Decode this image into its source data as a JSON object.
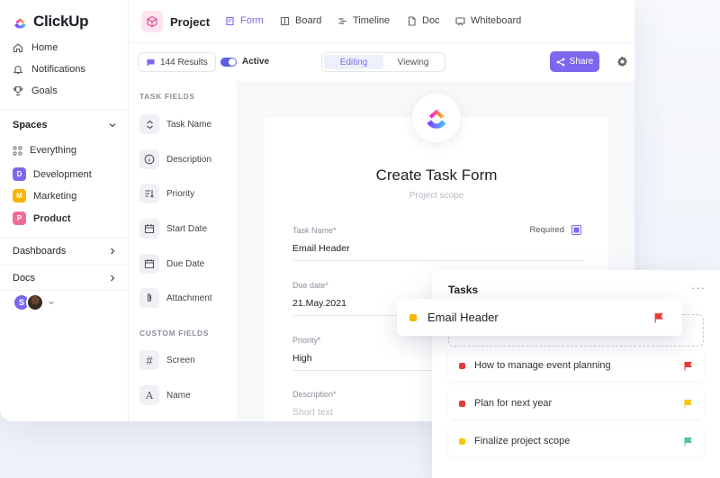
{
  "app": {
    "name": "ClickUp"
  },
  "sidebar": {
    "nav": [
      {
        "label": "Home",
        "icon": "home-icon"
      },
      {
        "label": "Notifications",
        "icon": "bell-icon"
      },
      {
        "label": "Goals",
        "icon": "trophy-icon"
      }
    ],
    "spaces_label": "Spaces",
    "everything_label": "Everything",
    "spaces": [
      {
        "letter": "D",
        "label": "Development",
        "color": "#7b68ee"
      },
      {
        "letter": "M",
        "label": "Marketing",
        "color": "#f7b500"
      },
      {
        "letter": "P",
        "label": "Product",
        "color": "#f06a9a"
      }
    ],
    "dashboards_label": "Dashboards",
    "docs_label": "Docs",
    "avatar_letter": "S"
  },
  "header": {
    "project_title": "Project",
    "tabs": [
      {
        "label": "Form",
        "icon": "form-icon"
      },
      {
        "label": "Board",
        "icon": "board-icon"
      },
      {
        "label": "Timeline",
        "icon": "timeline-icon"
      },
      {
        "label": "Doc",
        "icon": "doc-icon"
      },
      {
        "label": "Whiteboard",
        "icon": "whiteboard-icon"
      }
    ]
  },
  "toolbar": {
    "results": "144 Results",
    "active_label": "Active",
    "editing": "Editing",
    "viewing": "Viewing",
    "share": "Share"
  },
  "fields_panel": {
    "task_fields_head": "TASK FIELDS",
    "task_fields": [
      {
        "label": "Task Name",
        "icon": "task-name-icon"
      },
      {
        "label": "Description",
        "icon": "info-icon"
      },
      {
        "label": "Priority",
        "icon": "priority-icon"
      },
      {
        "label": "Start Date",
        "icon": "calendar-icon"
      },
      {
        "label": "Due Date",
        "icon": "calendar-icon"
      },
      {
        "label": "Attachment",
        "icon": "paperclip-icon"
      }
    ],
    "custom_fields_head": "CUSTOM FIELDS",
    "custom_fields": [
      {
        "label": "Screen",
        "glyph": "#"
      },
      {
        "label": "Name",
        "glyph": "A"
      }
    ]
  },
  "form": {
    "title": "Create Task Form",
    "subtitle": "Project scope",
    "required_label": "Required",
    "fields": [
      {
        "label": "Task Name*",
        "value": "Email Header"
      },
      {
        "label": "Due date*",
        "value": "21.May.2021"
      },
      {
        "label": "Priority*",
        "value": "High"
      },
      {
        "label": "Description*",
        "value": "Short text"
      }
    ]
  },
  "tasks_panel": {
    "title": "Tasks",
    "more": "···",
    "dragging": {
      "label": "Email Header",
      "dot_color": "#f7b500",
      "flag_color": "#e53935"
    },
    "items": [
      {
        "label": "How to manage event planning",
        "dot_color": "#e53935",
        "flag_color": "#e53935"
      },
      {
        "label": "Plan for next year",
        "dot_color": "#e53935",
        "flag_color": "#f7c500"
      },
      {
        "label": "Finalize project scope",
        "dot_color": "#f7c500",
        "flag_color": "#4cc3a7"
      }
    ]
  },
  "colors": {
    "accent": "#7b68ee"
  }
}
